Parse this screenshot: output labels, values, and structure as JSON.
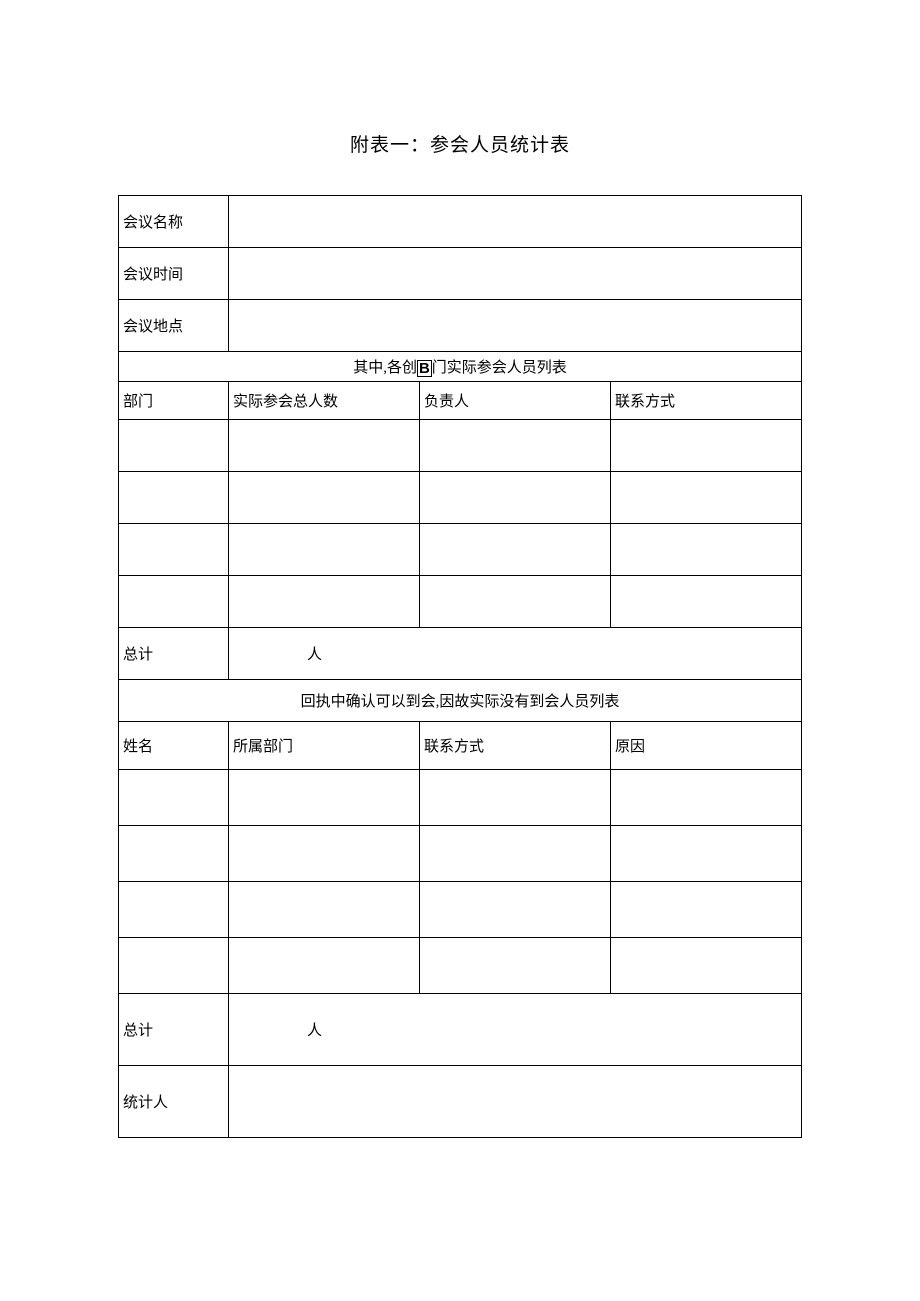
{
  "title": "附表一：参会人员统计表",
  "meeting": {
    "name_label": "会议名称",
    "time_label": "会议时间",
    "place_label": "会议地点",
    "name_value": "",
    "time_value": "",
    "place_value": ""
  },
  "section1": {
    "header_prefix": "其中,各创",
    "header_b": "B",
    "header_suffix": "门实际参会人员列表",
    "col1": "部门",
    "col2": "实际参会总人数",
    "col3": "负责人",
    "col4": "联系方式",
    "rows": [
      {
        "c1": "",
        "c2": "",
        "c3": "",
        "c4": ""
      },
      {
        "c1": "",
        "c2": "",
        "c3": "",
        "c4": ""
      },
      {
        "c1": "",
        "c2": "",
        "c3": "",
        "c4": ""
      },
      {
        "c1": "",
        "c2": "",
        "c3": "",
        "c4": ""
      }
    ],
    "total_label": "总计",
    "total_unit": "人",
    "total_value": ""
  },
  "section2": {
    "header": "回执中确认可以到会,因故实际没有到会人员列表",
    "col1": "姓名",
    "col2": "所属部门",
    "col3": "联系方式",
    "col4": "原因",
    "rows": [
      {
        "c1": "",
        "c2": "",
        "c3": "",
        "c4": ""
      },
      {
        "c1": "",
        "c2": "",
        "c3": "",
        "c4": ""
      },
      {
        "c1": "",
        "c2": "",
        "c3": "",
        "c4": ""
      },
      {
        "c1": "",
        "c2": "",
        "c3": "",
        "c4": ""
      }
    ],
    "total_label": "总计",
    "total_unit": "人",
    "total_value": ""
  },
  "statistician": {
    "label": "统计人",
    "value": ""
  }
}
